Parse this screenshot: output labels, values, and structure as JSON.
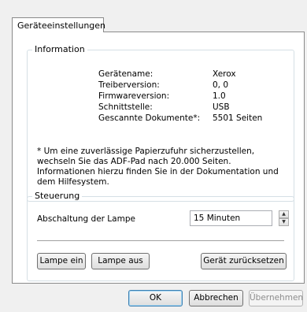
{
  "tab": {
    "label": "Geräteeinstellungen"
  },
  "info": {
    "title": "Information",
    "rows": [
      {
        "label": "Gerätename:",
        "value": "Xerox"
      },
      {
        "label": "Treiberversion:",
        "value": "0, 0"
      },
      {
        "label": "Firmwareversion:",
        "value": "1.0"
      },
      {
        "label": "Schnittstelle:",
        "value": "USB"
      },
      {
        "label": "Gescannte Dokumente*:",
        "value": "5501 Seiten"
      }
    ],
    "note": "* Um eine zuverlässige Papierzufuhr sicherzustellen, wechseln Sie das ADF-Pad nach 20.000 Seiten. Informationen hierzu finden Sie in der Dokumentation und dem Hilfesystem."
  },
  "control": {
    "title": "Steuerung",
    "lamp_off_label": "Abschaltung der Lampe",
    "lamp_off_value": "15 Minuten",
    "lamp_on_button": "Lampe ein",
    "lamp_out_button": "Lampe aus",
    "reset_button": "Gerät zurücksetzen"
  },
  "footer": {
    "ok": "OK",
    "cancel": "Abbrechen",
    "apply": "Übernehmen"
  }
}
